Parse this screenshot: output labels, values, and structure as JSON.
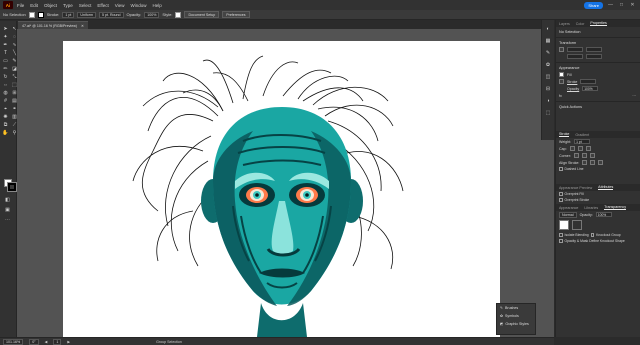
{
  "app": {
    "logo_text": "Ai",
    "menu": [
      "File",
      "Edit",
      "Object",
      "Type",
      "Select",
      "Effect",
      "View",
      "Window",
      "Help"
    ],
    "share_label": "Share",
    "window_controls": [
      "—",
      "□",
      "✕"
    ]
  },
  "control_bar": {
    "selection_label": "No Selection",
    "stroke_label": "Stroke:",
    "stroke_value": "1 pt",
    "profile_value": "Uniform",
    "brush_value": "5 pt. Round",
    "opacity_label": "Opacity:",
    "opacity_value": "100%",
    "style_label": "Style:",
    "doc_setup_label": "Document Setup",
    "preferences_label": "Preferences"
  },
  "document_tab": {
    "title": "47.ai* @ 101.16 % (RGB/Preview)",
    "close_icon": "close-icon"
  },
  "status_bar": {
    "zoom": "101.16%",
    "rotation": "0°",
    "artboard_num": "1",
    "tool_name": "Group Selection"
  },
  "panels": {
    "top_tabs": [
      "Layers",
      "Color",
      "Properties"
    ],
    "active_tab": "Properties",
    "no_selection": "No Selection",
    "transform_title": "Transform",
    "appearance_title": "Appearance",
    "fill_label": "Fill",
    "stroke_label": "Stroke",
    "opacity_label": "Opacity",
    "opacity_value": "100%",
    "stroke_value": "",
    "fx_label": "fx",
    "quick_actions_title": "Quick Actions",
    "stroke_panel_tabs": [
      "Stroke",
      "Gradient"
    ],
    "weight_label": "Weight:",
    "weight_value": "1 pt",
    "cap_label": "Cap:",
    "corner_label": "Corner:",
    "align_label": "Align Stroke:",
    "dashed_label": "Dashed Line",
    "attr_tabs": [
      "Appearance Preview",
      "Attributes"
    ],
    "overprint_fill": "Overprint Fill",
    "overprint_stroke": "Overprint Stroke",
    "transparency_tabs": [
      "Appearance",
      "Libraries",
      "Transparency"
    ],
    "blend_mode": "Normal",
    "opacity2_label": "Opacity:",
    "opacity2_value": "100%",
    "isolate_label": "Isolate Blending",
    "knockout_label": "Knockout Group",
    "opacity_mask_label": "Opacity & Mask Define Knockout Shape"
  },
  "float_panel": {
    "items": [
      "Brushes",
      "Symbols",
      "Graphic Styles"
    ]
  },
  "colors": {
    "accent": "#1473e6",
    "face": "#1aa7a3",
    "face_dark": "#0b5a5d",
    "face_light": "#8be3dc",
    "eye": "#ff7a4a"
  }
}
